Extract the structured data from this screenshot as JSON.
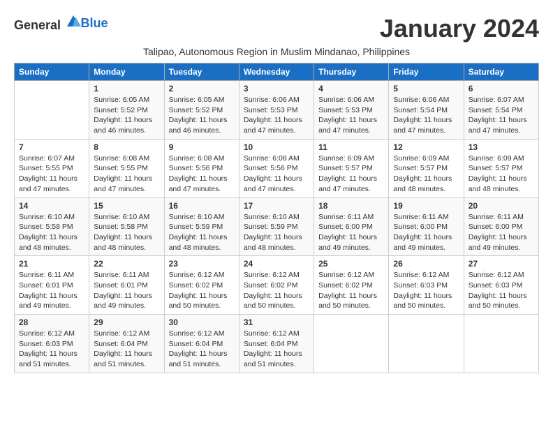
{
  "logo": {
    "general": "General",
    "blue": "Blue"
  },
  "title": "January 2024",
  "subtitle": "Talipao, Autonomous Region in Muslim Mindanao, Philippines",
  "headers": [
    "Sunday",
    "Monday",
    "Tuesday",
    "Wednesday",
    "Thursday",
    "Friday",
    "Saturday"
  ],
  "weeks": [
    [
      {
        "day": "",
        "sunrise": "",
        "sunset": "",
        "daylight": ""
      },
      {
        "day": "1",
        "sunrise": "Sunrise: 6:05 AM",
        "sunset": "Sunset: 5:52 PM",
        "daylight": "Daylight: 11 hours and 46 minutes."
      },
      {
        "day": "2",
        "sunrise": "Sunrise: 6:05 AM",
        "sunset": "Sunset: 5:52 PM",
        "daylight": "Daylight: 11 hours and 46 minutes."
      },
      {
        "day": "3",
        "sunrise": "Sunrise: 6:06 AM",
        "sunset": "Sunset: 5:53 PM",
        "daylight": "Daylight: 11 hours and 47 minutes."
      },
      {
        "day": "4",
        "sunrise": "Sunrise: 6:06 AM",
        "sunset": "Sunset: 5:53 PM",
        "daylight": "Daylight: 11 hours and 47 minutes."
      },
      {
        "day": "5",
        "sunrise": "Sunrise: 6:06 AM",
        "sunset": "Sunset: 5:54 PM",
        "daylight": "Daylight: 11 hours and 47 minutes."
      },
      {
        "day": "6",
        "sunrise": "Sunrise: 6:07 AM",
        "sunset": "Sunset: 5:54 PM",
        "daylight": "Daylight: 11 hours and 47 minutes."
      }
    ],
    [
      {
        "day": "7",
        "sunrise": "Sunrise: 6:07 AM",
        "sunset": "Sunset: 5:55 PM",
        "daylight": "Daylight: 11 hours and 47 minutes."
      },
      {
        "day": "8",
        "sunrise": "Sunrise: 6:08 AM",
        "sunset": "Sunset: 5:55 PM",
        "daylight": "Daylight: 11 hours and 47 minutes."
      },
      {
        "day": "9",
        "sunrise": "Sunrise: 6:08 AM",
        "sunset": "Sunset: 5:56 PM",
        "daylight": "Daylight: 11 hours and 47 minutes."
      },
      {
        "day": "10",
        "sunrise": "Sunrise: 6:08 AM",
        "sunset": "Sunset: 5:56 PM",
        "daylight": "Daylight: 11 hours and 47 minutes."
      },
      {
        "day": "11",
        "sunrise": "Sunrise: 6:09 AM",
        "sunset": "Sunset: 5:57 PM",
        "daylight": "Daylight: 11 hours and 47 minutes."
      },
      {
        "day": "12",
        "sunrise": "Sunrise: 6:09 AM",
        "sunset": "Sunset: 5:57 PM",
        "daylight": "Daylight: 11 hours and 48 minutes."
      },
      {
        "day": "13",
        "sunrise": "Sunrise: 6:09 AM",
        "sunset": "Sunset: 5:57 PM",
        "daylight": "Daylight: 11 hours and 48 minutes."
      }
    ],
    [
      {
        "day": "14",
        "sunrise": "Sunrise: 6:10 AM",
        "sunset": "Sunset: 5:58 PM",
        "daylight": "Daylight: 11 hours and 48 minutes."
      },
      {
        "day": "15",
        "sunrise": "Sunrise: 6:10 AM",
        "sunset": "Sunset: 5:58 PM",
        "daylight": "Daylight: 11 hours and 48 minutes."
      },
      {
        "day": "16",
        "sunrise": "Sunrise: 6:10 AM",
        "sunset": "Sunset: 5:59 PM",
        "daylight": "Daylight: 11 hours and 48 minutes."
      },
      {
        "day": "17",
        "sunrise": "Sunrise: 6:10 AM",
        "sunset": "Sunset: 5:59 PM",
        "daylight": "Daylight: 11 hours and 48 minutes."
      },
      {
        "day": "18",
        "sunrise": "Sunrise: 6:11 AM",
        "sunset": "Sunset: 6:00 PM",
        "daylight": "Daylight: 11 hours and 49 minutes."
      },
      {
        "day": "19",
        "sunrise": "Sunrise: 6:11 AM",
        "sunset": "Sunset: 6:00 PM",
        "daylight": "Daylight: 11 hours and 49 minutes."
      },
      {
        "day": "20",
        "sunrise": "Sunrise: 6:11 AM",
        "sunset": "Sunset: 6:00 PM",
        "daylight": "Daylight: 11 hours and 49 minutes."
      }
    ],
    [
      {
        "day": "21",
        "sunrise": "Sunrise: 6:11 AM",
        "sunset": "Sunset: 6:01 PM",
        "daylight": "Daylight: 11 hours and 49 minutes."
      },
      {
        "day": "22",
        "sunrise": "Sunrise: 6:11 AM",
        "sunset": "Sunset: 6:01 PM",
        "daylight": "Daylight: 11 hours and 49 minutes."
      },
      {
        "day": "23",
        "sunrise": "Sunrise: 6:12 AM",
        "sunset": "Sunset: 6:02 PM",
        "daylight": "Daylight: 11 hours and 50 minutes."
      },
      {
        "day": "24",
        "sunrise": "Sunrise: 6:12 AM",
        "sunset": "Sunset: 6:02 PM",
        "daylight": "Daylight: 11 hours and 50 minutes."
      },
      {
        "day": "25",
        "sunrise": "Sunrise: 6:12 AM",
        "sunset": "Sunset: 6:02 PM",
        "daylight": "Daylight: 11 hours and 50 minutes."
      },
      {
        "day": "26",
        "sunrise": "Sunrise: 6:12 AM",
        "sunset": "Sunset: 6:03 PM",
        "daylight": "Daylight: 11 hours and 50 minutes."
      },
      {
        "day": "27",
        "sunrise": "Sunrise: 6:12 AM",
        "sunset": "Sunset: 6:03 PM",
        "daylight": "Daylight: 11 hours and 50 minutes."
      }
    ],
    [
      {
        "day": "28",
        "sunrise": "Sunrise: 6:12 AM",
        "sunset": "Sunset: 6:03 PM",
        "daylight": "Daylight: 11 hours and 51 minutes."
      },
      {
        "day": "29",
        "sunrise": "Sunrise: 6:12 AM",
        "sunset": "Sunset: 6:04 PM",
        "daylight": "Daylight: 11 hours and 51 minutes."
      },
      {
        "day": "30",
        "sunrise": "Sunrise: 6:12 AM",
        "sunset": "Sunset: 6:04 PM",
        "daylight": "Daylight: 11 hours and 51 minutes."
      },
      {
        "day": "31",
        "sunrise": "Sunrise: 6:12 AM",
        "sunset": "Sunset: 6:04 PM",
        "daylight": "Daylight: 11 hours and 51 minutes."
      },
      {
        "day": "",
        "sunrise": "",
        "sunset": "",
        "daylight": ""
      },
      {
        "day": "",
        "sunrise": "",
        "sunset": "",
        "daylight": ""
      },
      {
        "day": "",
        "sunrise": "",
        "sunset": "",
        "daylight": ""
      }
    ]
  ]
}
